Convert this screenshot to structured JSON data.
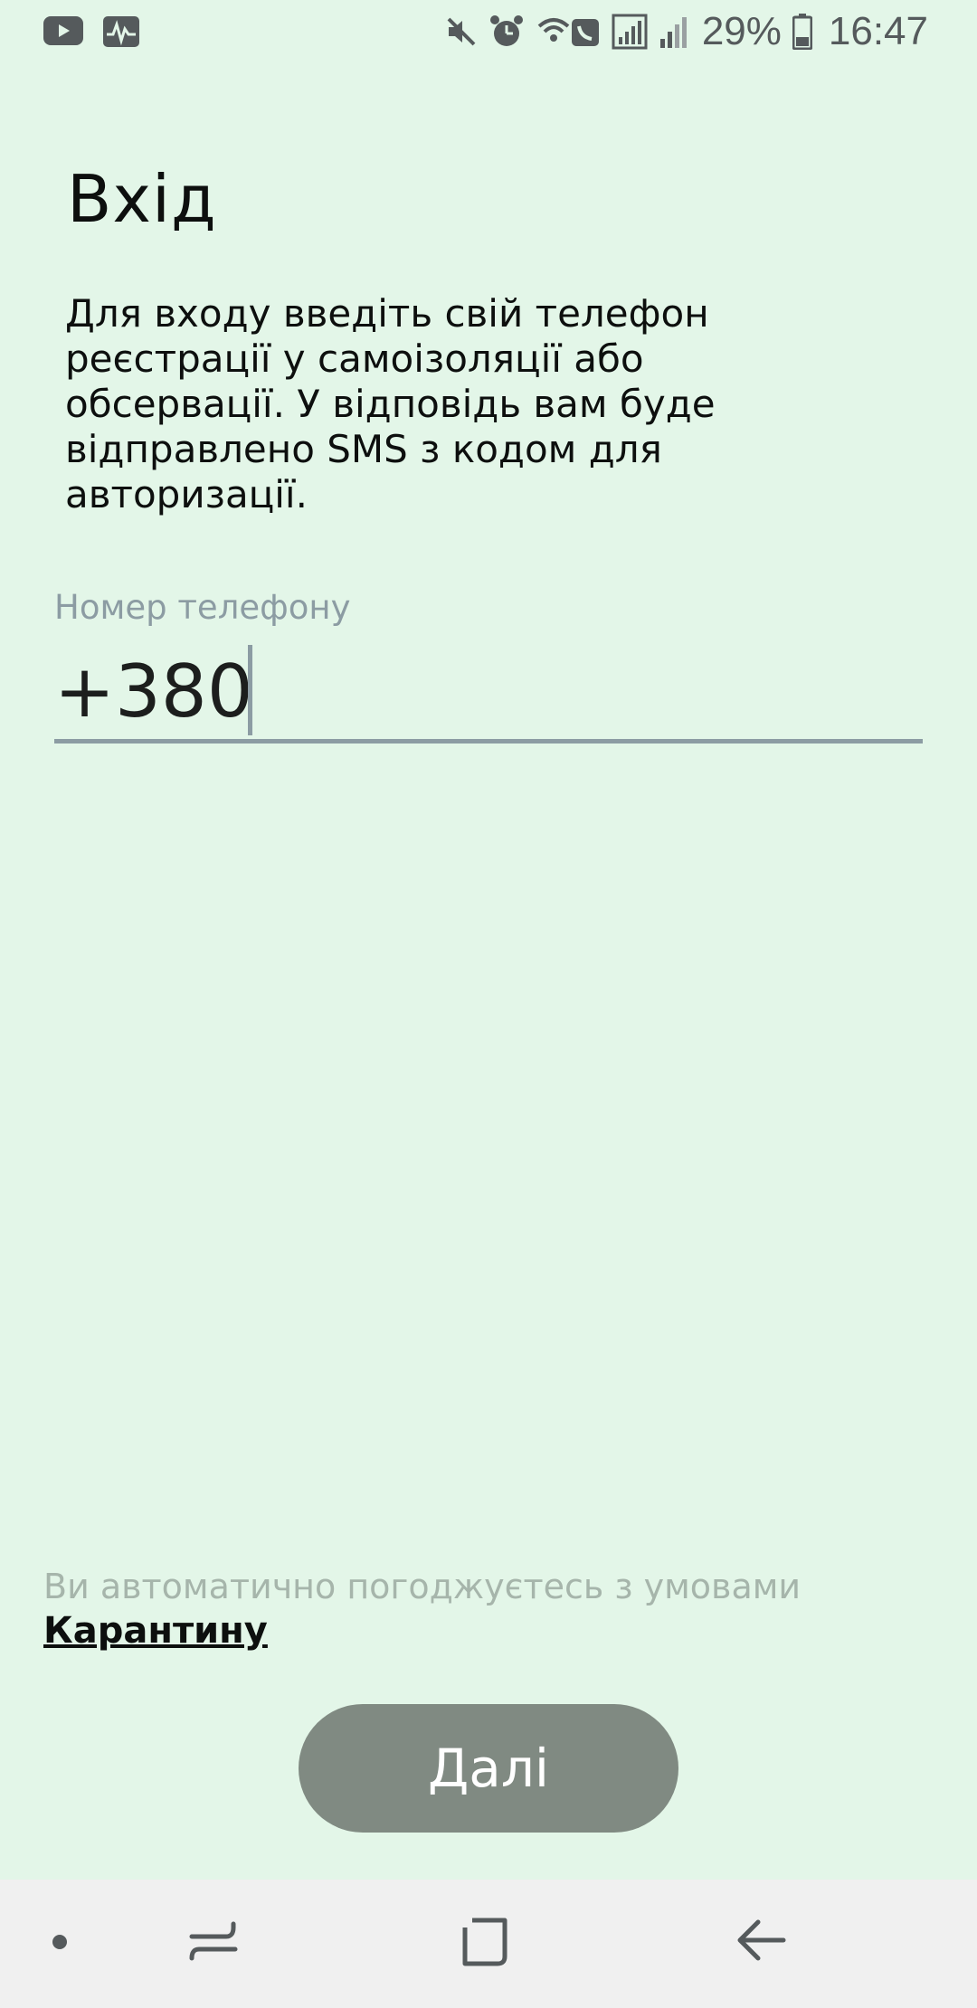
{
  "status_bar": {
    "battery_percent": "29%",
    "time": "16:47",
    "left_icons": [
      "youtube-icon",
      "activity-icon"
    ],
    "right_icons": [
      "mute-icon",
      "alarm-icon",
      "wifi-call-icon",
      "signal-icon",
      "signal-weak-icon",
      "battery-icon"
    ]
  },
  "login": {
    "title": "Вхід",
    "description": "Для входу введіть свій телефон реєстрації у самоізоляції або обсервації. У відповідь вам буде відправлено SMS з кодом для авторизації.",
    "phone_label": "Номер телефону",
    "phone_prefix": "+380",
    "phone_value": ""
  },
  "terms": {
    "text": "Ви автоматично погоджуєтесь з умовами",
    "link": "Карантину"
  },
  "next_button": {
    "label": "Далі"
  },
  "nav_bar": {
    "items": [
      "dot-icon",
      "recent-apps-icon",
      "home-icon",
      "back-icon"
    ]
  },
  "colors": {
    "background": "#e3f6e8",
    "button": "#808a82",
    "label": "#8c9ca3",
    "terms_text": "#a6b5ab"
  }
}
